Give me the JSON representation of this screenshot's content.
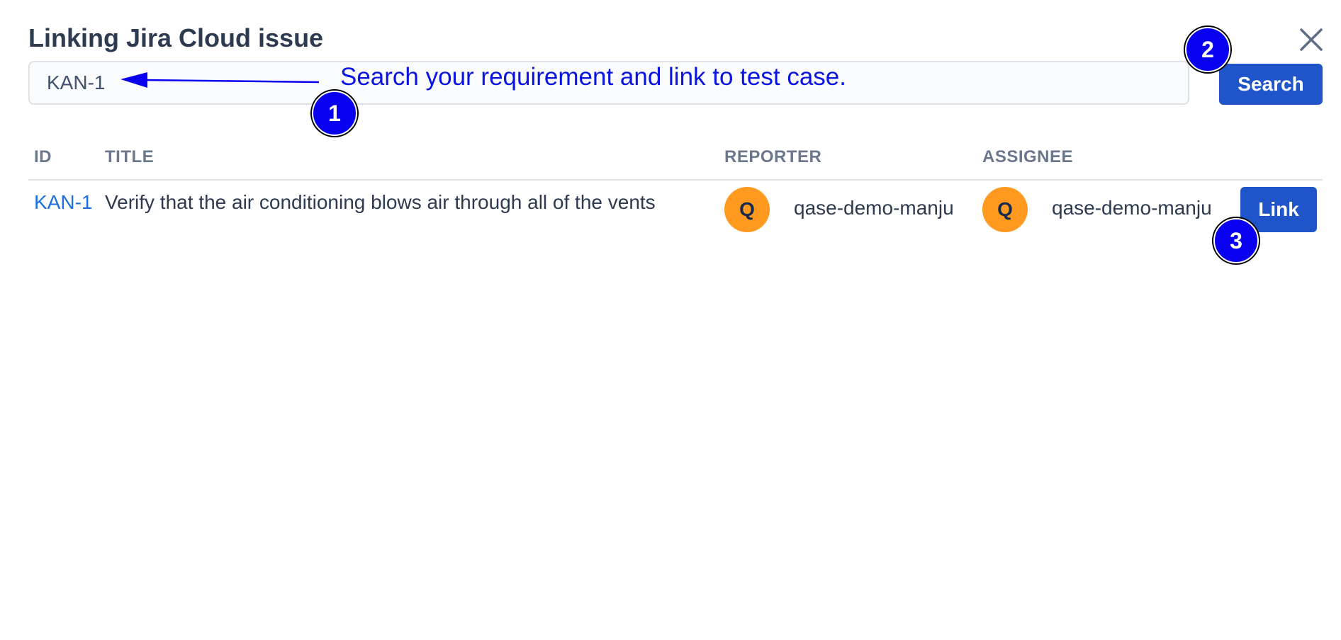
{
  "dialog": {
    "title": "Linking Jira Cloud issue",
    "close_icon": "close-icon"
  },
  "search": {
    "value": "KAN-1",
    "button_label": "Search"
  },
  "annotations": {
    "text": "Search your requirement and link to test case.",
    "badges": [
      "1",
      "2",
      "3"
    ],
    "color": "#0a00f0"
  },
  "table": {
    "columns": [
      "ID",
      "TITLE",
      "REPORTER",
      "ASSIGNEE"
    ],
    "rows": [
      {
        "id": "KAN-1",
        "title": "Verify that the air conditioning blows air through all of the vents",
        "reporter": {
          "initial": "Q",
          "name": "qase-demo-manju"
        },
        "assignee": {
          "initial": "Q",
          "name": "qase-demo-manju"
        },
        "action_label": "Link"
      }
    ]
  },
  "colors": {
    "primary_button": "#1f55c8",
    "link": "#1d6fe0",
    "avatar": "#ff991f"
  }
}
